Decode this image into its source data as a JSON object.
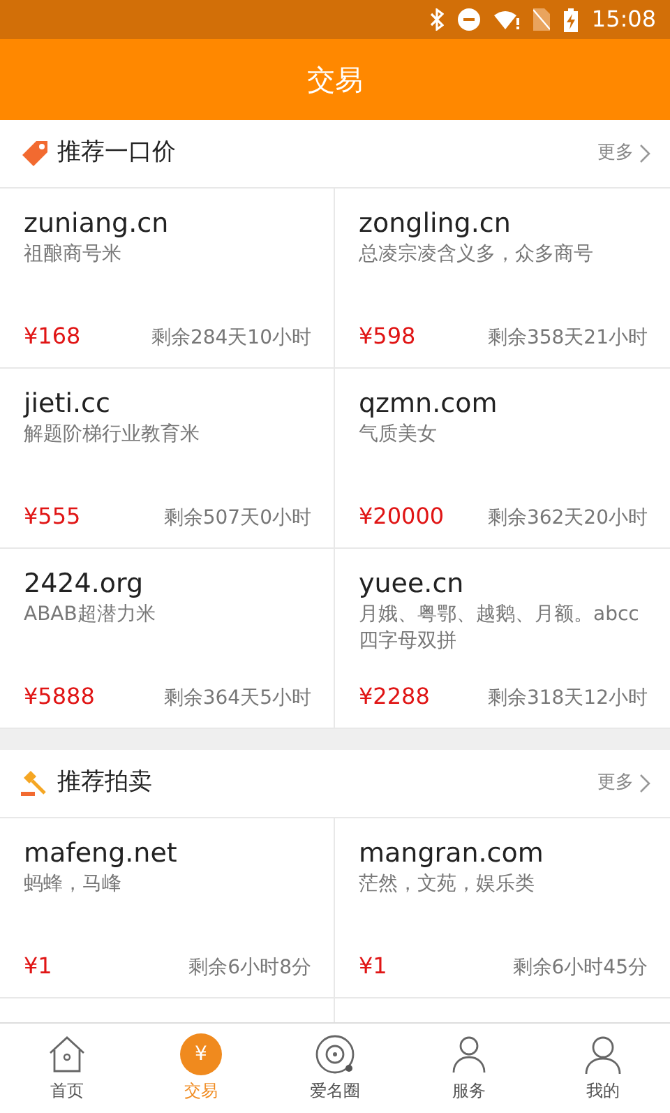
{
  "status_bar": {
    "time": "15:08"
  },
  "header": {
    "title": "交易"
  },
  "sections": [
    {
      "kind": "fixed",
      "title": "推荐一口价",
      "more": "更多",
      "items": [
        {
          "domain": "zuniang.cn",
          "desc": "祖酿商号米",
          "price": "¥168",
          "remaining": "剩余284天10小时"
        },
        {
          "domain": "zongling.cn",
          "desc": "总凌宗凌含义多，众多商号",
          "price": "¥598",
          "remaining": "剩余358天21小时"
        },
        {
          "domain": "jieti.cc",
          "desc": "解题阶梯行业教育米",
          "price": "¥555",
          "remaining": "剩余507天0小时"
        },
        {
          "domain": "qzmn.com",
          "desc": "气质美女",
          "price": "¥20000",
          "remaining": "剩余362天20小时"
        },
        {
          "domain": "2424.org",
          "desc": "ABAB超潜力米",
          "price": "¥5888",
          "remaining": "剩余364天5小时"
        },
        {
          "domain": "yuee.cn",
          "desc": "月娥、粤鄂、越鹅、月额。abcc四字母双拼",
          "price": "¥2288",
          "remaining": "剩余318天12小时"
        }
      ]
    },
    {
      "kind": "auction",
      "title": "推荐拍卖",
      "more": "更多",
      "items": [
        {
          "domain": "mafeng.net",
          "desc": "蚂蜂，马峰",
          "price": "¥1",
          "remaining": "剩余6小时8分"
        },
        {
          "domain": "mangran.com",
          "desc": "茫然，文苑，娱乐类",
          "price": "¥1",
          "remaining": "剩余6小时45分"
        }
      ]
    }
  ],
  "tabs": [
    {
      "kind": "home",
      "label": "首页",
      "selected": false
    },
    {
      "kind": "trade",
      "label": "交易",
      "badge_text": "¥",
      "selected": true
    },
    {
      "kind": "circle",
      "label": "爱名圈",
      "selected": false
    },
    {
      "kind": "service",
      "label": "服务",
      "selected": false
    },
    {
      "kind": "mine",
      "label": "我的",
      "selected": false
    }
  ]
}
